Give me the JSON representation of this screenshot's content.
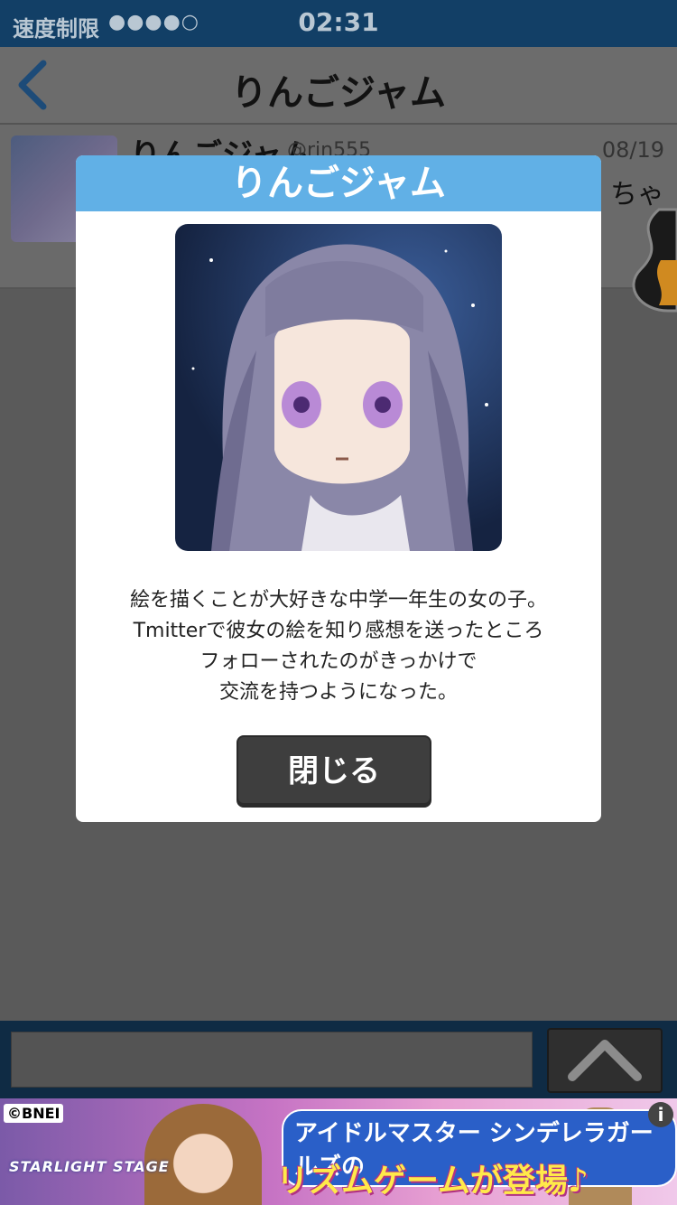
{
  "status_bar": {
    "carrier": "速度制限",
    "signal_dots": "●●●●○",
    "time": "02:31"
  },
  "nav": {
    "title": "りんごジャム",
    "back_icon": "chevron-left-icon"
  },
  "message_row": {
    "name": "りんごジャム",
    "handle": "@rin555",
    "date": "08/19",
    "preview_fragment": "ちゃ"
  },
  "modal": {
    "title": "りんごジャム",
    "description_lines": [
      "絵を描くことが大好きな中学一年生の女の子。",
      "Tmitterで彼女の絵を知り感想を送ったところ",
      "フォローされたのがきっかけで",
      "交流を持つようになった。"
    ],
    "close_label": "閉じる"
  },
  "input_bar": {
    "send_icon": "chevron-up-icon"
  },
  "banner": {
    "copyright": "©BNEI",
    "logo_text": "STARLIGHT STAGE",
    "headline": "アイドルマスター シンデレラガールズの",
    "subheadline": "リズムゲームが登場♪",
    "info_icon": "i"
  },
  "colors": {
    "status_bar": "#123f66",
    "modal_header": "#61b0e6",
    "overlay": "#5a5a5a"
  }
}
